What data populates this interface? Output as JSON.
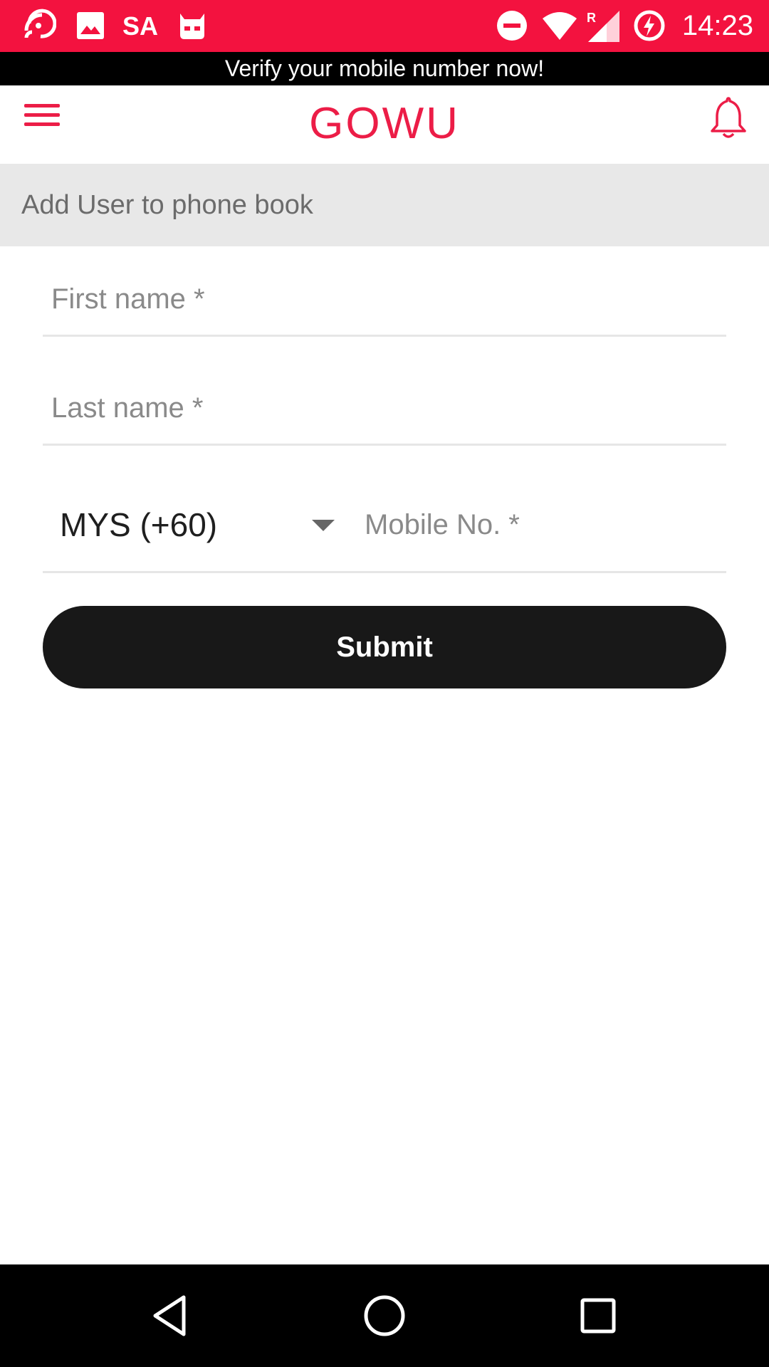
{
  "status_bar": {
    "carrier_label": "SA",
    "time": "14:23",
    "background_color": "#f3123f",
    "icons": [
      "cast-icon",
      "image-icon",
      "cyanogen-icon",
      "do-not-disturb-icon",
      "wifi-icon",
      "signal-roaming-icon",
      "battery-charging-icon"
    ]
  },
  "banner": {
    "text": "Verify your mobile number now!"
  },
  "app_bar": {
    "logo_text": "GOWU",
    "accent_color": "#ec1d47",
    "icons": [
      "menu-icon",
      "bell-icon"
    ]
  },
  "section": {
    "title": "Add User to phone book"
  },
  "form": {
    "first_name_placeholder": "First name *",
    "last_name_placeholder": "Last name *",
    "country_code_value": "MYS (+60)",
    "mobile_placeholder": "Mobile No. *",
    "submit_label": "Submit"
  },
  "nav_bar": {
    "icons": [
      "back-icon",
      "home-icon",
      "recents-icon"
    ]
  }
}
